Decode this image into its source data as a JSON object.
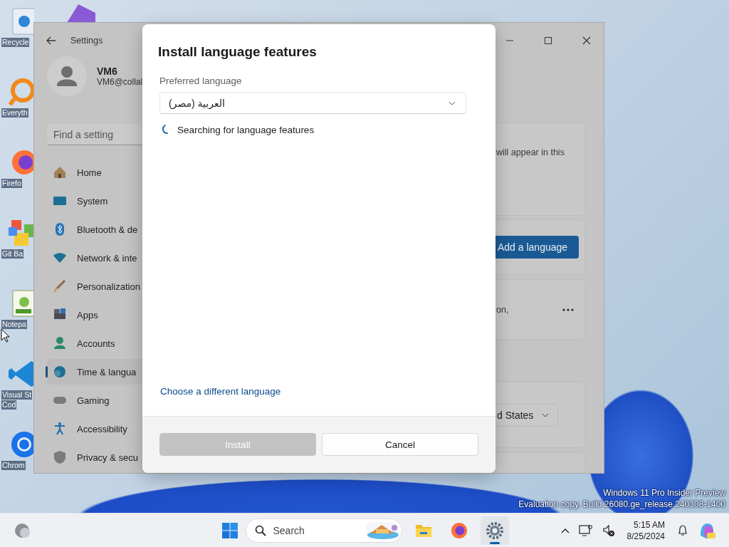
{
  "desktop_icons": [
    {
      "kind": "recycle",
      "label_lines": [
        "Recycle"
      ]
    },
    {
      "kind": "search-app",
      "label_lines": [
        "Everyth"
      ]
    },
    {
      "kind": "firefox",
      "label_lines": [
        "Firefo"
      ]
    },
    {
      "kind": "git",
      "label_lines": [
        "Git Ba"
      ]
    },
    {
      "kind": "notepad",
      "label_lines": [
        "Notepa"
      ]
    },
    {
      "kind": "vscode",
      "label_lines": [
        "Visual St",
        "Cod"
      ]
    },
    {
      "kind": "chrome",
      "label_lines": [
        "Chrom"
      ]
    }
  ],
  "settings_window": {
    "title": "Settings",
    "account": {
      "name": "VM6",
      "email": "VM6@collal"
    },
    "search": {
      "placeholder": "Find a setting"
    },
    "nav_items": [
      {
        "kind": "home",
        "label": "Home",
        "selected": false
      },
      {
        "kind": "system",
        "label": "System",
        "selected": false
      },
      {
        "kind": "bluetooth",
        "label": "Bluetooth & de",
        "selected": false
      },
      {
        "kind": "network",
        "label": "Network & inte",
        "selected": false
      },
      {
        "kind": "personalization",
        "label": "Personalization",
        "selected": false
      },
      {
        "kind": "apps",
        "label": "Apps",
        "selected": false
      },
      {
        "kind": "accounts",
        "label": "Accounts",
        "selected": false
      },
      {
        "kind": "time",
        "label": "Time & langua",
        "selected": true
      },
      {
        "kind": "gaming",
        "label": "Gaming",
        "selected": false
      },
      {
        "kind": "accessibility",
        "label": "Accessibility",
        "selected": false
      },
      {
        "kind": "privacy",
        "label": "Privacy & secu",
        "selected": false
      }
    ],
    "cards": [
      {
        "kind": "text",
        "text": "will appear in this"
      },
      {
        "kind": "button",
        "label": "Add a language"
      },
      {
        "kind": "more",
        "text": "on,"
      },
      {
        "kind": "dropdown",
        "value": "d States"
      },
      {
        "kind": "empty"
      }
    ]
  },
  "dialog": {
    "title": "Install language features",
    "field_label": "Preferred language",
    "language": {
      "value": "العربية (مصر)"
    },
    "status": "Searching for language features",
    "link": "Choose a different language",
    "install_button": {
      "label": "Install",
      "disabled": true
    },
    "cancel_button": {
      "label": "Cancel"
    }
  },
  "watermark_lines": [
    "Windows 11 Pro Insider Preview",
    "Evaluation copy. Build 26080.ge_release.240308-1400"
  ],
  "taskbar": {
    "search": {
      "placeholder": "Search"
    },
    "apps": [
      {
        "kind": "explorer",
        "active": false
      },
      {
        "kind": "firefox",
        "active": false
      },
      {
        "kind": "settings",
        "active": true
      }
    ],
    "time": "5:15 AM",
    "date": "8/25/2024"
  }
}
